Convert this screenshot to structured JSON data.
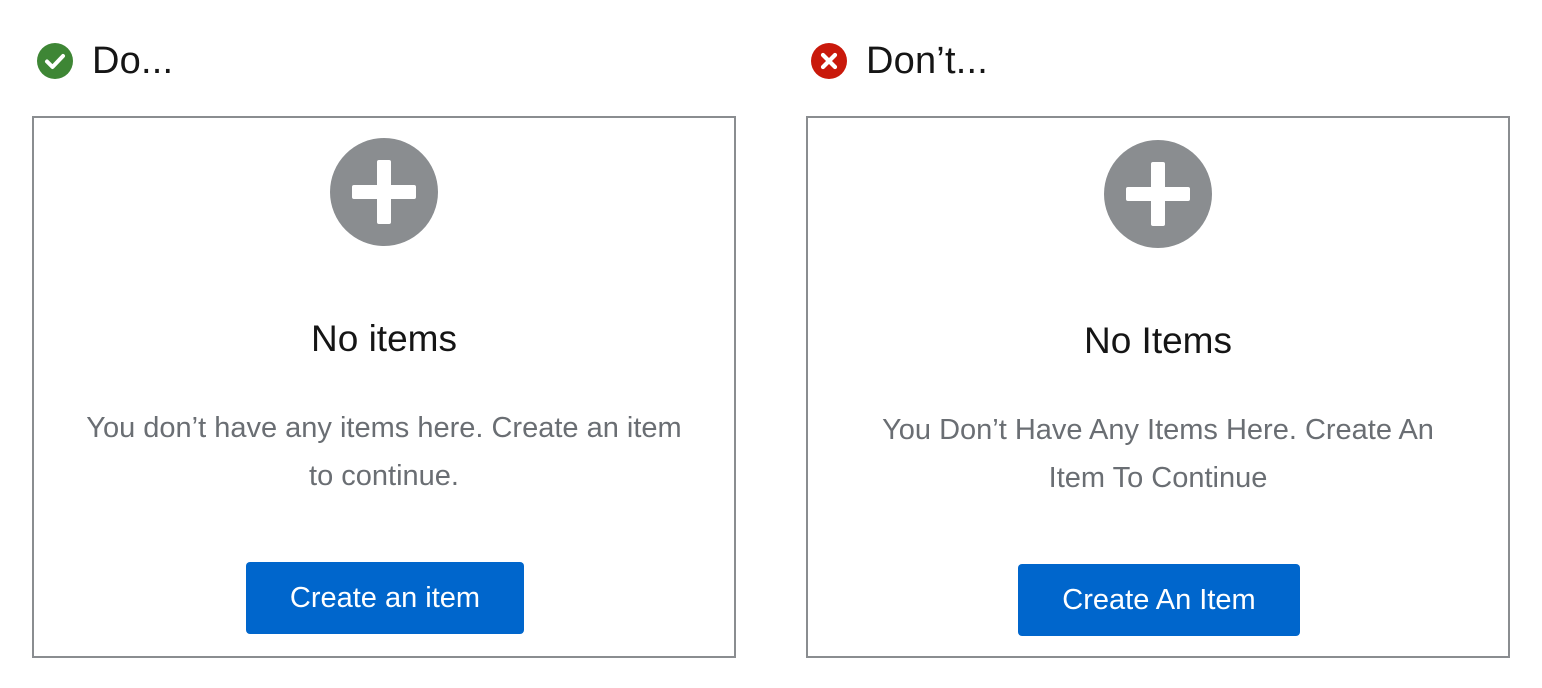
{
  "colors": {
    "do_icon": "#3e8635",
    "dont_icon": "#c9190b",
    "empty_icon": "#8a8d90",
    "button": "#0066cc",
    "border": "#8a8d90",
    "body_text": "#6a6e73",
    "title_text": "#151515"
  },
  "do": {
    "heading": "Do...",
    "icon": "check-circle-icon",
    "card": {
      "icon": "plus-circle-icon",
      "title": "No items",
      "body": "You don’t have any items here. Create an item to continue.",
      "button_label": "Create an item"
    }
  },
  "dont": {
    "heading": "Don’t...",
    "icon": "times-circle-icon",
    "card": {
      "icon": "plus-circle-icon",
      "title": "No Items",
      "body": "You Don’t Have Any Items Here. Create An Item To Continue",
      "button_label": "Create An Item"
    }
  }
}
